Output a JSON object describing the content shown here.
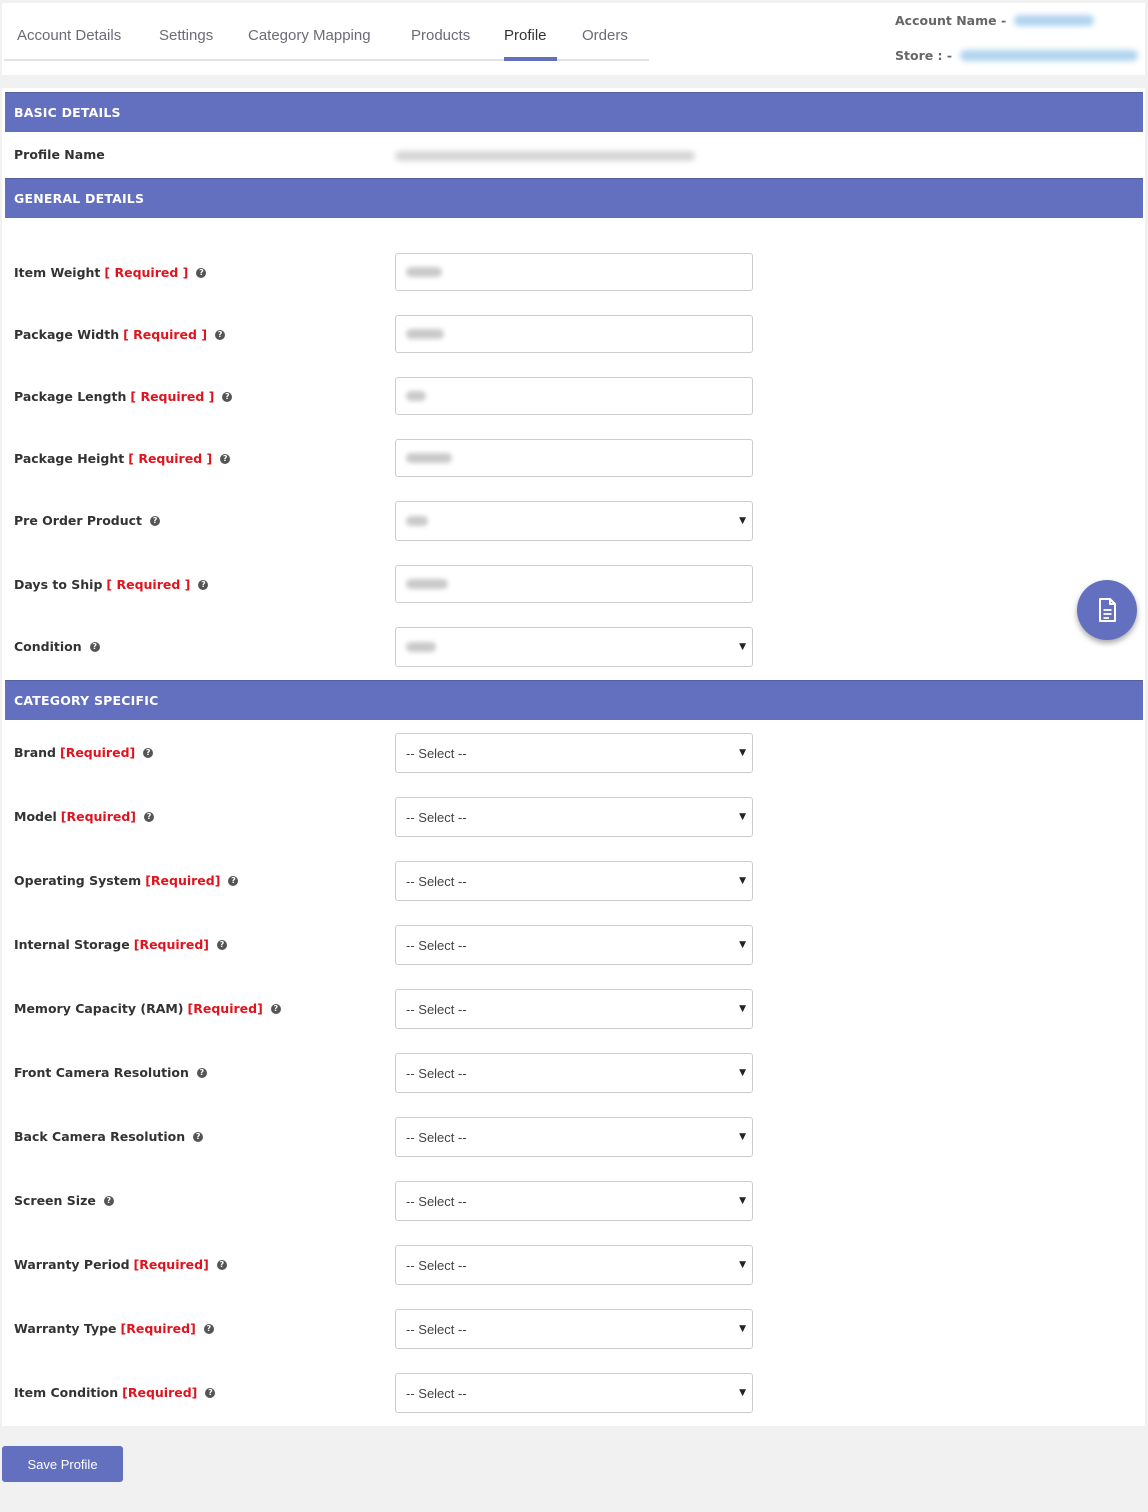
{
  "tabs": [
    {
      "label": "Account Details",
      "active": false
    },
    {
      "label": "Settings",
      "active": false
    },
    {
      "label": "Category Mapping",
      "active": false
    },
    {
      "label": "Products",
      "active": false
    },
    {
      "label": "Profile",
      "active": true
    },
    {
      "label": "Orders",
      "active": false
    }
  ],
  "account": {
    "name_label": "Account Name -",
    "store_label": "Store : -"
  },
  "sections": {
    "basic": "BASIC DETAILS",
    "general": "GENERAL DETAILS",
    "category": "CATEGORY SPECIFIC"
  },
  "basic": {
    "profile_name_label": "Profile Name"
  },
  "general_fields": [
    {
      "label": "Item Weight",
      "required": "[ Required ]",
      "type": "input"
    },
    {
      "label": "Package Width",
      "required": "[ Required ]",
      "type": "input"
    },
    {
      "label": "Package Length",
      "required": "[ Required ]",
      "type": "input"
    },
    {
      "label": "Package Height",
      "required": "[ Required ]",
      "type": "input"
    },
    {
      "label": "Pre Order Product",
      "required": "",
      "type": "select"
    },
    {
      "label": "Days to Ship",
      "required": "[ Required ]",
      "type": "input"
    },
    {
      "label": "Condition",
      "required": "",
      "type": "select"
    }
  ],
  "category_fields": [
    {
      "label": "Brand",
      "required": "[Required]",
      "value": "-- Select --"
    },
    {
      "label": "Model",
      "required": "[Required]",
      "value": "-- Select --"
    },
    {
      "label": "Operating System",
      "required": "[Required]",
      "value": "-- Select --"
    },
    {
      "label": "Internal Storage",
      "required": "[Required]",
      "value": "-- Select --"
    },
    {
      "label": "Memory Capacity (RAM)",
      "required": "[Required]",
      "value": "-- Select --"
    },
    {
      "label": "Front Camera Resolution",
      "required": "",
      "value": "-- Select --"
    },
    {
      "label": "Back Camera Resolution",
      "required": "",
      "value": "-- Select --"
    },
    {
      "label": "Screen Size",
      "required": "",
      "value": "-- Select --"
    },
    {
      "label": "Warranty Period",
      "required": "[Required]",
      "value": "-- Select --"
    },
    {
      "label": "Warranty Type",
      "required": "[Required]",
      "value": "-- Select --"
    },
    {
      "label": "Item Condition",
      "required": "[Required]",
      "value": "-- Select --"
    }
  ],
  "icons": {
    "help": "question-circle-icon",
    "fab": "document-icon",
    "caret": "caret-down-icon"
  },
  "colors": {
    "accent": "#6370bf",
    "required": "#e0141e"
  },
  "save_label": "Save Profile"
}
